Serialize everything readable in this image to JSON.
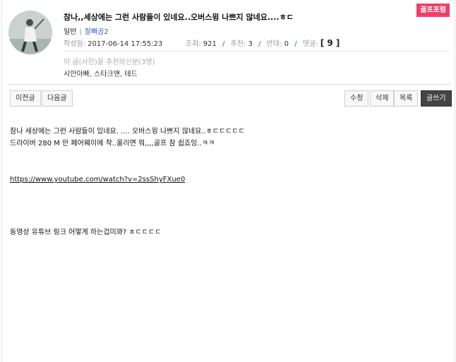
{
  "badge": "골프포럼",
  "post": {
    "title": "참나,,세상에는 그런 사람들이 있네요..오버스윙 나쁘지 않네요....ㅎㄷ",
    "category": "일반",
    "author": "잘빠곰2",
    "date_label": "작성일:",
    "date": "2017-06-14 17:55:23",
    "views_label": "조회:",
    "views": "921",
    "recommend_label": "추천:",
    "recommend": "3",
    "oppose_label": "반대:",
    "oppose": "0",
    "replies_label": "댓글:",
    "replies": "[ 9 ]"
  },
  "recommenders": {
    "label": "이 글(사진)을 추천하신분(3명)",
    "names": "시안아빠, 스타크맨, 테드"
  },
  "toolbar": {
    "prev": "이전글",
    "next": "다음글",
    "edit": "수정",
    "delete": "삭제",
    "list": "목록",
    "write": "글쓰기"
  },
  "content": {
    "line1": "참나 세상에는 그런 사람들이 있네요. .... 오버스윙 나쁘지 않네요..ㅎㄷㄷㄷㄷㄷ",
    "line2": "드라이버 280 M 만 페어웨이에 착..올리면 뭐,,,,골프 참 쉽죠잉..ㅋㅋ",
    "link": "https://www.youtube.com/watch?v=2ssShyFXue0",
    "question": "동영상 유튜브 링크 어떻게 하는겁미꽈? ㅎㄷㄷㄷㄷ"
  }
}
